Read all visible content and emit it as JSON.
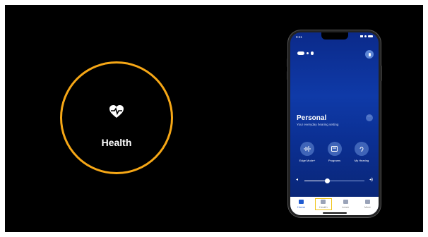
{
  "highlight": {
    "icon": "heart-pulse-icon",
    "label": "Health",
    "ring_color": "#f6a716"
  },
  "phone": {
    "status_time": "9:41",
    "program_title": "Personal",
    "program_subtitle": "Your everyday hearing setting",
    "actions": [
      {
        "icon": "waveform-icon",
        "label": "Edge Mode+"
      },
      {
        "icon": "programs-icon",
        "label": "Programs"
      },
      {
        "icon": "ear-icon",
        "label": "My Hearing"
      }
    ],
    "volume_level": 0.38,
    "tabs": [
      {
        "icon": "home-icon",
        "label": "Home"
      },
      {
        "icon": "health-icon",
        "label": "Health"
      },
      {
        "icon": "learn-icon",
        "label": "Learn"
      },
      {
        "icon": "more-icon",
        "label": "More"
      }
    ]
  }
}
